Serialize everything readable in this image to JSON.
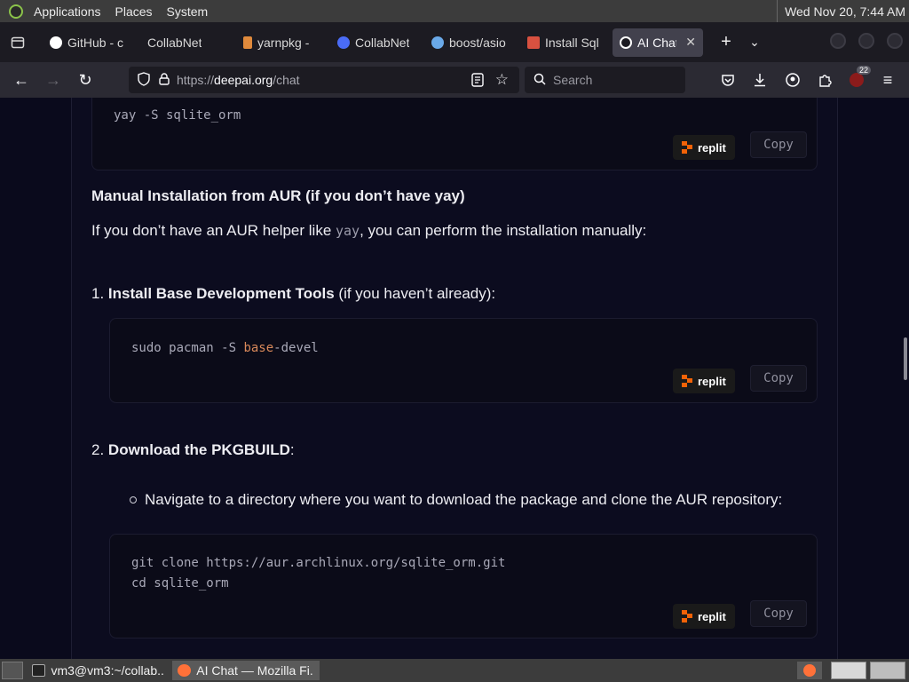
{
  "system_panel": {
    "menus": [
      "Applications",
      "Places",
      "System"
    ],
    "clock": "Wed Nov 20, 7:44 AM"
  },
  "browser": {
    "tabs": [
      {
        "label": "GitHub - c",
        "icon": "github-icon",
        "color": "#ffffff",
        "active": false
      },
      {
        "label": "CollabNet",
        "icon": "collabnet-icon",
        "color": "#1c1b22",
        "active": false
      },
      {
        "label": "yarnpkg -",
        "icon": "yarn-icon",
        "color": "#e08a3c",
        "active": false
      },
      {
        "label": "CollabNet",
        "icon": "collabnet-icon",
        "color": "#4a6cf7",
        "active": false
      },
      {
        "label": "boost/asio",
        "icon": "boost-icon",
        "color": "#6aa9e8",
        "active": false
      },
      {
        "label": "Install Sql",
        "icon": "gmail-icon",
        "color": "#d85140",
        "active": false
      },
      {
        "label": "AI Chat",
        "icon": "deepai-icon",
        "color": "#ffffff",
        "active": true
      }
    ],
    "url_prefix": "https://",
    "url_host": "deepai.org",
    "url_path": "/chat",
    "search_placeholder": "Search",
    "extension_badge": "22"
  },
  "content": {
    "code1": "yay -S sqlite_orm",
    "heading_manual": "Manual Installation from AUR (if you don’t have yay)",
    "para_prefix": "If you don’t have an AUR helper like ",
    "para_code": "yay",
    "para_suffix": ", you can perform the installation manually:",
    "step1_num": "1.",
    "step1_bold": "Install Base Development Tools",
    "step1_rest": " (if you haven’t already):",
    "code2_a": "sudo pacman -S ",
    "code2_kw": "base",
    "code2_b": "-devel",
    "step2_num": "2.",
    "step2_bold": "Download the PKGBUILD",
    "step2_rest": ":",
    "bullet_text": "Navigate to a directory where you want to download the package and clone the AUR repository:",
    "code3_line1": "git clone https://aur.archlinux.org/sqlite_orm.git",
    "code3_line2": "cd sqlite_orm",
    "replit_label": "replit",
    "copy_label": "Copy"
  },
  "taskbar": {
    "tasks": [
      {
        "label": "vm3@vm3:~/collab...",
        "icon": "terminal-icon",
        "active": false
      },
      {
        "label": "AI Chat — Mozilla Fi...",
        "icon": "firefox-icon",
        "active": true
      }
    ]
  }
}
